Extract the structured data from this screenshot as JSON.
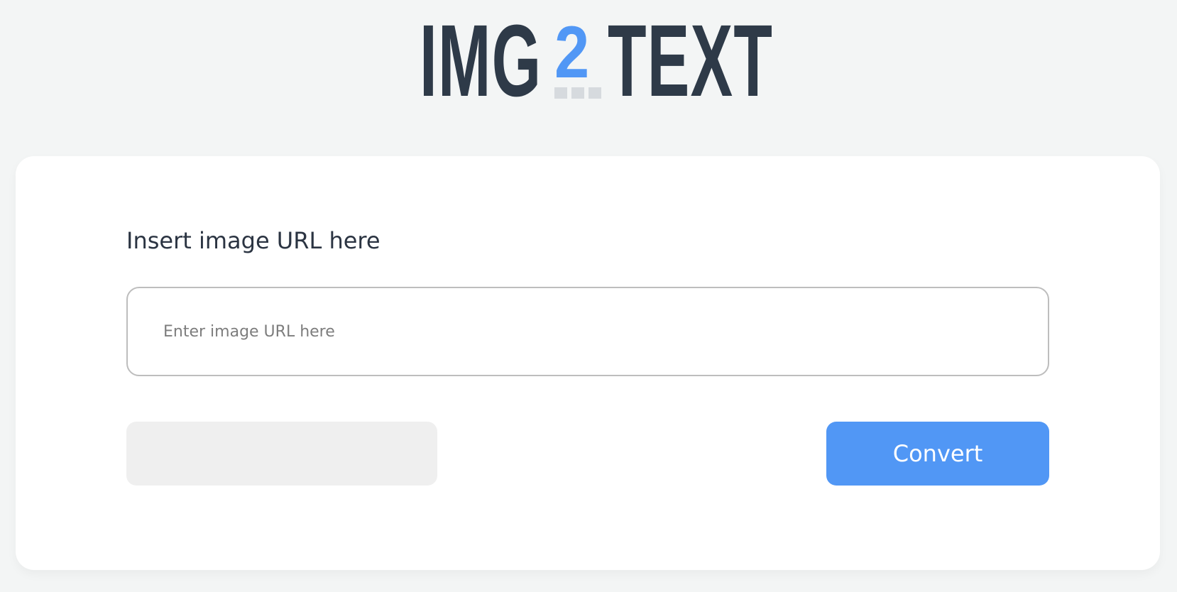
{
  "logo": {
    "part_img": "IMG",
    "part_two": "2",
    "part_text": "TEXT"
  },
  "form": {
    "label": "Insert image URL here",
    "input_placeholder": "Enter image URL here",
    "input_value": "",
    "convert_label": "Convert"
  },
  "colors": {
    "brand_dark": "#2e3a48",
    "accent": "#5197f5",
    "background": "#f3f5f5"
  }
}
